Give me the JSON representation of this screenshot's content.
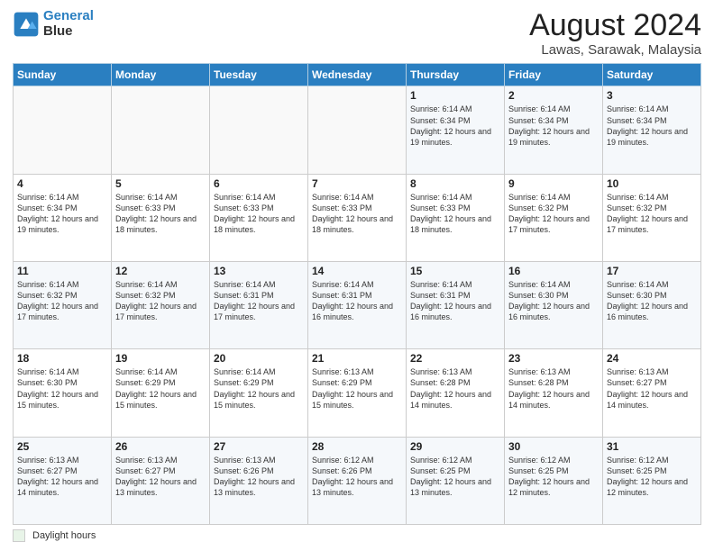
{
  "header": {
    "logo_line1": "General",
    "logo_line2": "Blue",
    "main_title": "August 2024",
    "sub_title": "Lawas, Sarawak, Malaysia"
  },
  "calendar": {
    "days_of_week": [
      "Sunday",
      "Monday",
      "Tuesday",
      "Wednesday",
      "Thursday",
      "Friday",
      "Saturday"
    ],
    "weeks": [
      [
        {
          "day": "",
          "info": ""
        },
        {
          "day": "",
          "info": ""
        },
        {
          "day": "",
          "info": ""
        },
        {
          "day": "",
          "info": ""
        },
        {
          "day": "1",
          "info": "Sunrise: 6:14 AM\nSunset: 6:34 PM\nDaylight: 12 hours\nand 19 minutes."
        },
        {
          "day": "2",
          "info": "Sunrise: 6:14 AM\nSunset: 6:34 PM\nDaylight: 12 hours\nand 19 minutes."
        },
        {
          "day": "3",
          "info": "Sunrise: 6:14 AM\nSunset: 6:34 PM\nDaylight: 12 hours\nand 19 minutes."
        }
      ],
      [
        {
          "day": "4",
          "info": "Sunrise: 6:14 AM\nSunset: 6:34 PM\nDaylight: 12 hours\nand 19 minutes."
        },
        {
          "day": "5",
          "info": "Sunrise: 6:14 AM\nSunset: 6:33 PM\nDaylight: 12 hours\nand 18 minutes."
        },
        {
          "day": "6",
          "info": "Sunrise: 6:14 AM\nSunset: 6:33 PM\nDaylight: 12 hours\nand 18 minutes."
        },
        {
          "day": "7",
          "info": "Sunrise: 6:14 AM\nSunset: 6:33 PM\nDaylight: 12 hours\nand 18 minutes."
        },
        {
          "day": "8",
          "info": "Sunrise: 6:14 AM\nSunset: 6:33 PM\nDaylight: 12 hours\nand 18 minutes."
        },
        {
          "day": "9",
          "info": "Sunrise: 6:14 AM\nSunset: 6:32 PM\nDaylight: 12 hours\nand 17 minutes."
        },
        {
          "day": "10",
          "info": "Sunrise: 6:14 AM\nSunset: 6:32 PM\nDaylight: 12 hours\nand 17 minutes."
        }
      ],
      [
        {
          "day": "11",
          "info": "Sunrise: 6:14 AM\nSunset: 6:32 PM\nDaylight: 12 hours\nand 17 minutes."
        },
        {
          "day": "12",
          "info": "Sunrise: 6:14 AM\nSunset: 6:32 PM\nDaylight: 12 hours\nand 17 minutes."
        },
        {
          "day": "13",
          "info": "Sunrise: 6:14 AM\nSunset: 6:31 PM\nDaylight: 12 hours\nand 17 minutes."
        },
        {
          "day": "14",
          "info": "Sunrise: 6:14 AM\nSunset: 6:31 PM\nDaylight: 12 hours\nand 16 minutes."
        },
        {
          "day": "15",
          "info": "Sunrise: 6:14 AM\nSunset: 6:31 PM\nDaylight: 12 hours\nand 16 minutes."
        },
        {
          "day": "16",
          "info": "Sunrise: 6:14 AM\nSunset: 6:30 PM\nDaylight: 12 hours\nand 16 minutes."
        },
        {
          "day": "17",
          "info": "Sunrise: 6:14 AM\nSunset: 6:30 PM\nDaylight: 12 hours\nand 16 minutes."
        }
      ],
      [
        {
          "day": "18",
          "info": "Sunrise: 6:14 AM\nSunset: 6:30 PM\nDaylight: 12 hours\nand 15 minutes."
        },
        {
          "day": "19",
          "info": "Sunrise: 6:14 AM\nSunset: 6:29 PM\nDaylight: 12 hours\nand 15 minutes."
        },
        {
          "day": "20",
          "info": "Sunrise: 6:14 AM\nSunset: 6:29 PM\nDaylight: 12 hours\nand 15 minutes."
        },
        {
          "day": "21",
          "info": "Sunrise: 6:13 AM\nSunset: 6:29 PM\nDaylight: 12 hours\nand 15 minutes."
        },
        {
          "day": "22",
          "info": "Sunrise: 6:13 AM\nSunset: 6:28 PM\nDaylight: 12 hours\nand 14 minutes."
        },
        {
          "day": "23",
          "info": "Sunrise: 6:13 AM\nSunset: 6:28 PM\nDaylight: 12 hours\nand 14 minutes."
        },
        {
          "day": "24",
          "info": "Sunrise: 6:13 AM\nSunset: 6:27 PM\nDaylight: 12 hours\nand 14 minutes."
        }
      ],
      [
        {
          "day": "25",
          "info": "Sunrise: 6:13 AM\nSunset: 6:27 PM\nDaylight: 12 hours\nand 14 minutes."
        },
        {
          "day": "26",
          "info": "Sunrise: 6:13 AM\nSunset: 6:27 PM\nDaylight: 12 hours\nand 13 minutes."
        },
        {
          "day": "27",
          "info": "Sunrise: 6:13 AM\nSunset: 6:26 PM\nDaylight: 12 hours\nand 13 minutes."
        },
        {
          "day": "28",
          "info": "Sunrise: 6:12 AM\nSunset: 6:26 PM\nDaylight: 12 hours\nand 13 minutes."
        },
        {
          "day": "29",
          "info": "Sunrise: 6:12 AM\nSunset: 6:25 PM\nDaylight: 12 hours\nand 13 minutes."
        },
        {
          "day": "30",
          "info": "Sunrise: 6:12 AM\nSunset: 6:25 PM\nDaylight: 12 hours\nand 12 minutes."
        },
        {
          "day": "31",
          "info": "Sunrise: 6:12 AM\nSunset: 6:25 PM\nDaylight: 12 hours\nand 12 minutes."
        }
      ]
    ]
  },
  "footer": {
    "daylight_label": "Daylight hours"
  }
}
